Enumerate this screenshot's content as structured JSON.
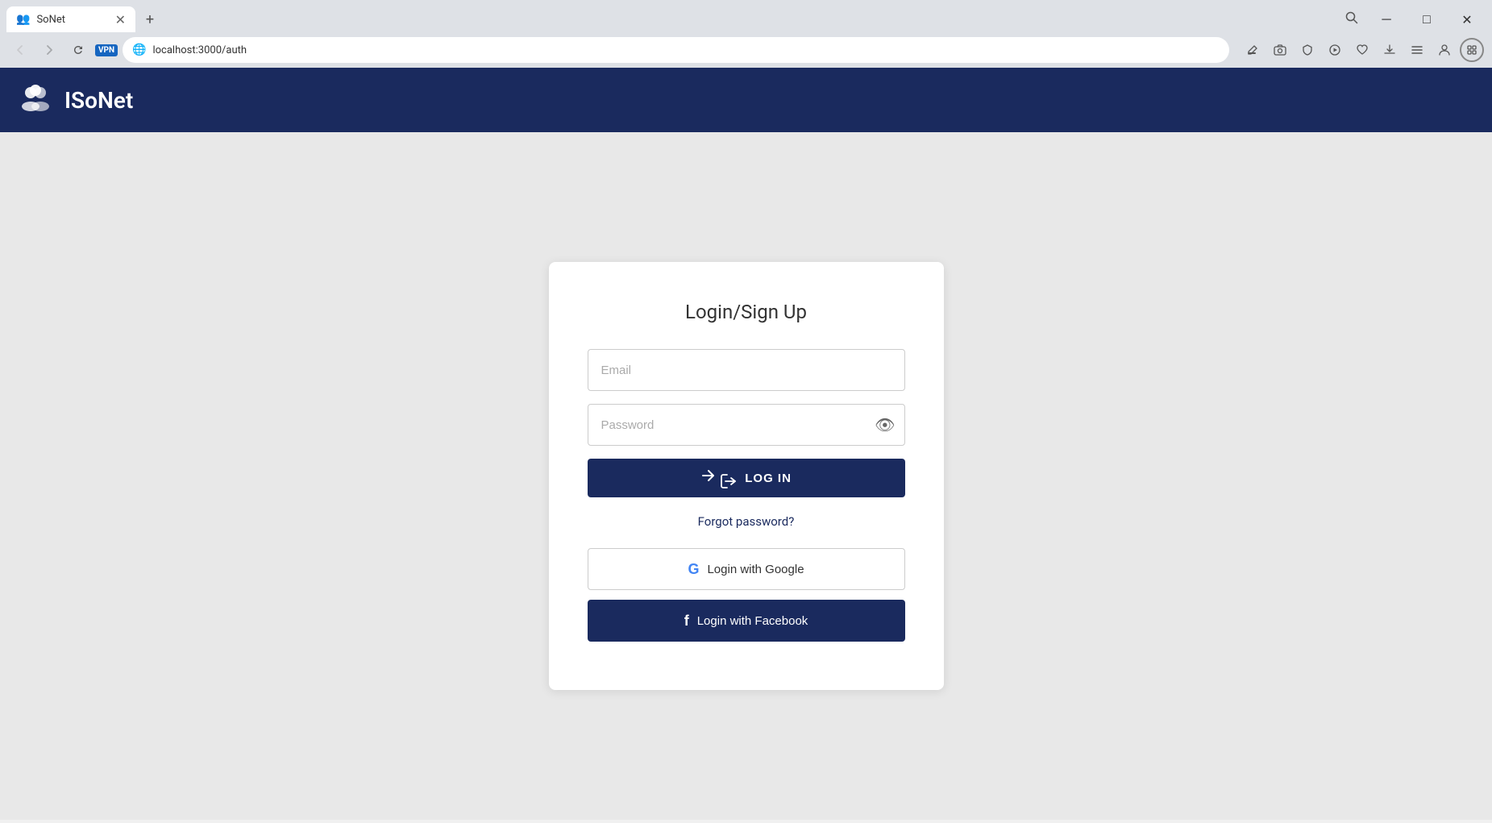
{
  "browser": {
    "tab": {
      "favicon": "👥",
      "title": "SoNet",
      "close_icon": "✕"
    },
    "new_tab_icon": "+",
    "search_icon": "🔍",
    "window_controls": {
      "minimize": "─",
      "maximize": "□",
      "close": "✕"
    },
    "nav": {
      "back": "←",
      "forward": "→",
      "refresh": "↻",
      "vpn_label": "VPN",
      "globe": "🌐",
      "url": "localhost:3000/auth"
    },
    "toolbar_icons": [
      "✏️",
      "📷",
      "🛡️",
      "▷",
      "♡",
      "⬇",
      "☰",
      "👤",
      "🧩"
    ]
  },
  "header": {
    "logo_icon": "👥",
    "app_name": "ISoNet"
  },
  "login_card": {
    "title": "Login/Sign Up",
    "email_placeholder": "Email",
    "password_placeholder": "Password",
    "toggle_password_icon": "👁",
    "login_button_icon": "→",
    "login_button_label": "LOG IN",
    "forgot_password_label": "Forgot password?",
    "google_button_label": "Login with Google",
    "google_icon": "G",
    "facebook_button_label": "Login with Facebook",
    "facebook_icon": "f"
  }
}
